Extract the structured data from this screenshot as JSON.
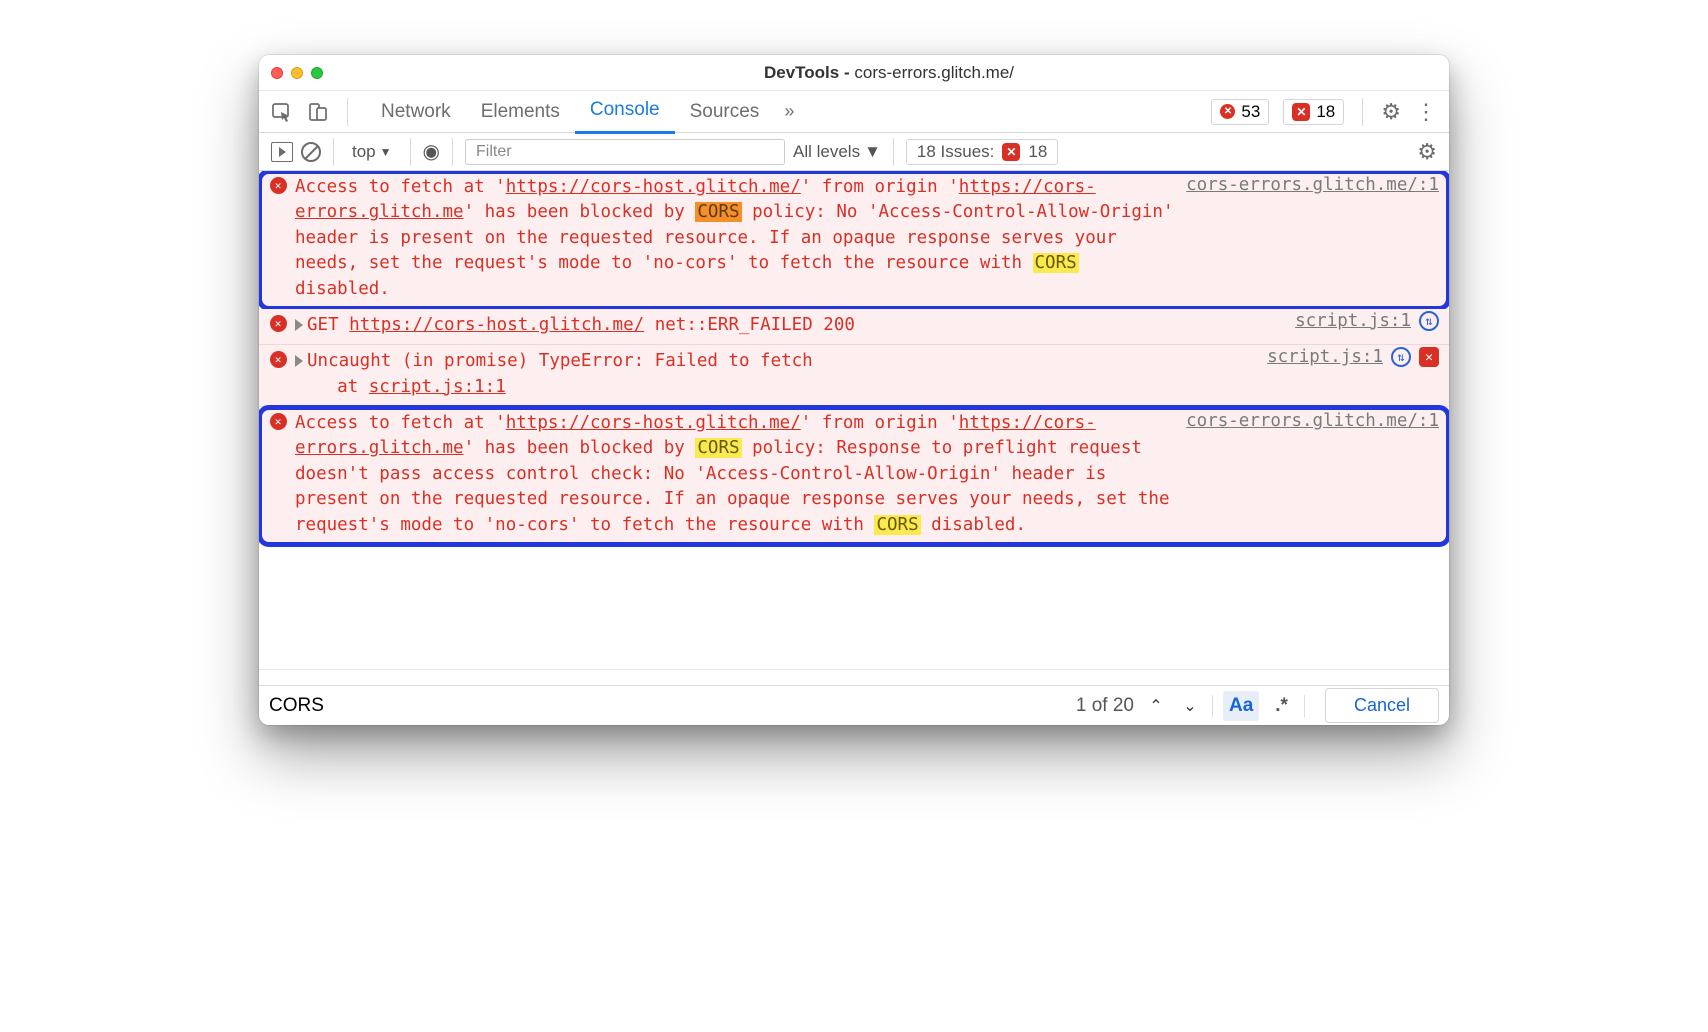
{
  "title": {
    "prefix": "DevTools - ",
    "url": "cors-errors.glitch.me/"
  },
  "tabs": {
    "network": "Network",
    "elements": "Elements",
    "console": "Console",
    "sources": "Sources"
  },
  "counts": {
    "errors": "53",
    "issues": "18"
  },
  "toolbar2": {
    "context": "top",
    "filter_placeholder": "Filter",
    "levels": "All levels",
    "issues_label": "18 Issues:",
    "issues_count": "18"
  },
  "messages": {
    "m1": {
      "src": "cors-errors.glitch.me/:1",
      "pre1": "Access to fetch at '",
      "url1": "https://cors-host.glitch.me/",
      "mid1": "' from origin '",
      "url2": "https://cors-errors.glitch.me",
      "mid2": "' has been blocked by ",
      "cors1": "CORS",
      "tail1": " policy: No 'Access-Control-Allow-Origin' header is present on the requested resource. If an opaque response serves your needs, set the request's mode to 'no-cors' to fetch the resource with ",
      "cors2": "CORS",
      "tail2": " disabled."
    },
    "m2": {
      "src": "script.js:1",
      "t1": "GET ",
      "url": "https://cors-host.glitch.me/",
      "t2": " net::ERR_FAILED 200"
    },
    "m3": {
      "src": "script.js:1",
      "line1": "Uncaught (in promise) TypeError: Failed to fetch",
      "line2_pre": "    at ",
      "line2_link": "script.js:1:1"
    },
    "m4": {
      "src": "cors-errors.glitch.me/:1",
      "pre1": "Access to fetch at '",
      "url1": "https://cors-host.glitch.me/",
      "mid1": "' from origin '",
      "url2": "https://cors-errors.glitch.me",
      "mid2": "' has been blocked by ",
      "cors1": "CORS",
      "tail1": " policy: Response to preflight request doesn't pass access control check: No 'Access-Control-Allow-Origin' header is present on the requested resource. If an opaque response serves your needs, set the request's mode to 'no-cors' to fetch the resource with ",
      "cors2": "CORS",
      "tail2": " disabled."
    }
  },
  "search": {
    "query": "CORS",
    "position": "1 of 20",
    "aa": "Aa",
    "regex": ".*",
    "cancel": "Cancel"
  }
}
